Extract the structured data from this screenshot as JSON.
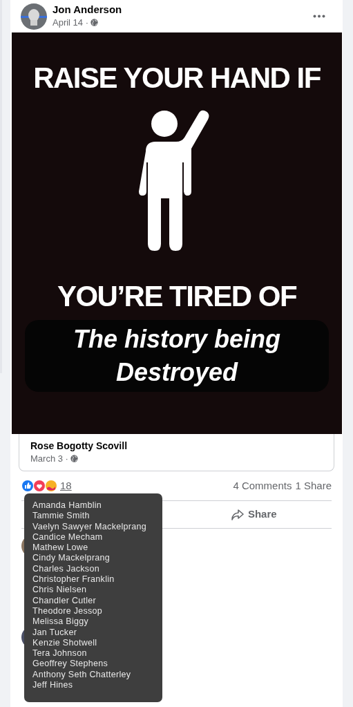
{
  "post": {
    "author": "Jon Anderson",
    "date": "April 14 ·",
    "image": {
      "line_1": "RAISE YOUR HAND IF",
      "line_2": "YOU’RE TIRED OF",
      "caption": [
        "The history being",
        "Destroyed"
      ]
    },
    "shared_from": {
      "author": "Rose Bogotty Scovill",
      "date": "March 3 ·"
    },
    "reaction_count": "18",
    "comments_count": "4 Comments",
    "shares_count": "1 Share",
    "share_label": "Share"
  },
  "reactions_tooltip": {
    "names": [
      "Amanda Hamblin",
      "Tammie Smith",
      "Vaelyn Sawyer Mackelprang",
      "Candice Mecham",
      "Mathew Lowe",
      "Cindy Mackelprang",
      "Charles Jackson",
      "Christopher Franklin",
      "Chris Nielsen",
      "Chandler Cutler",
      "Theodore Jessop",
      "Melissa Biggy",
      "Jan Tucker",
      "Kenzie Shotwell",
      "Tera Johnson",
      "Geoffrey Stephens",
      "Anthony Seth Chatterley",
      "Jeff Hines"
    ]
  }
}
